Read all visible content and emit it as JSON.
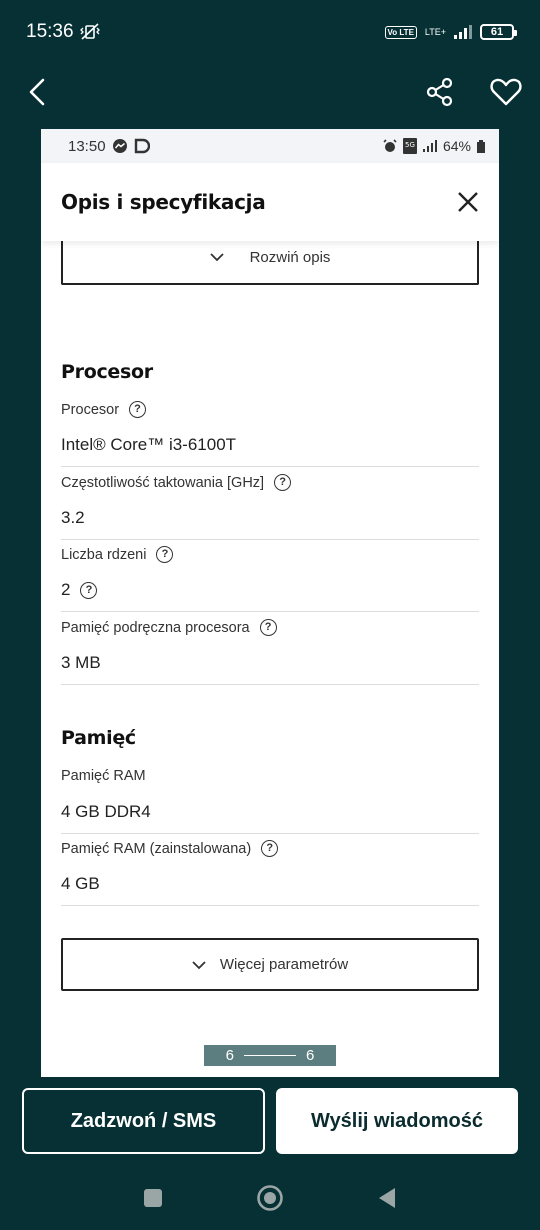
{
  "status_bar": {
    "time": "15:36",
    "network": "LTE+",
    "volte": "Vo LTE",
    "battery": "61"
  },
  "app_bar": {
    "back_icon": "chevron-left-icon",
    "share_icon": "share-icon",
    "favorite_icon": "heart-icon"
  },
  "photo": {
    "inner_status": {
      "time": "13:50",
      "battery": "64%"
    },
    "dialog": {
      "title": "Opis i specyfikacja",
      "close_icon": "close-icon",
      "expand_label": "Rozwiń opis"
    },
    "sections": [
      {
        "title": "Procesor",
        "rows": [
          {
            "label": "Procesor",
            "value": "Intel® Core™ i3-6100T"
          },
          {
            "label": "Częstotliwość taktowania [GHz]",
            "value": "3.2"
          },
          {
            "label": "Liczba rdzeni",
            "value": "2"
          },
          {
            "label": "Pamięć podręczna procesora",
            "value": "3 MB"
          }
        ]
      },
      {
        "title": "Pamięć",
        "rows": [
          {
            "label": "Pamięć RAM",
            "value": "4 GB DDR4"
          },
          {
            "label": "Pamięć RAM (zainstalowana)",
            "value": "4 GB"
          }
        ]
      }
    ],
    "more_params_label": "Więcej parametrów"
  },
  "pager": {
    "current": "6",
    "total": "6"
  },
  "actions": {
    "call_label": "Zadzwoń / SMS",
    "message_label": "Wyślij wiadomość"
  },
  "colors": {
    "background": "#063034",
    "pager": "#5d7e80",
    "message_text": "#0b2c2e"
  }
}
